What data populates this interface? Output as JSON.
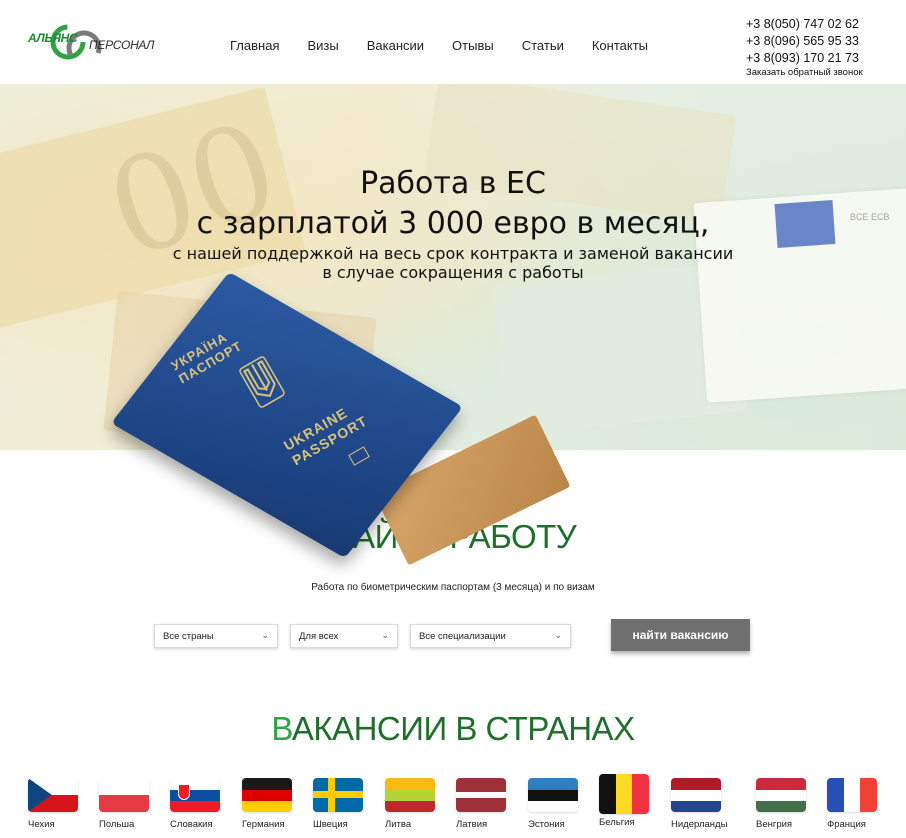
{
  "header": {
    "logo_part1": "АЛЬЯНС",
    "logo_part2": "ПЕРСОНАЛ",
    "nav": [
      "Главная",
      "Визы",
      "Вакансии",
      "Отывы",
      "Статьи",
      "Контакты"
    ],
    "phones": [
      "+3 8(050) 747 02 62",
      "+3 8(096) 565 95 33",
      "+3 8(093) 170 21 73"
    ],
    "callback": "Заказать обратный звонок"
  },
  "hero": {
    "title_line1": "Работа в ЕС",
    "title_line2": "с зарплатой 3 000 евро в месяц,",
    "subtitle": "с нашей поддержкой на весь срок контракта и заменой вакансии в случае сокращения с работы",
    "passport_ua": "УКРАЇНА ПАСПОРТ",
    "passport_en": "UKRAINE PASSPORT",
    "bill_mark": "BCE ECB"
  },
  "find": {
    "title_first": "Н",
    "title_rest": "АЙТИ РАБОТУ",
    "subtitle": "Работа по биометрическим паспортам (3 месяца) и по визам",
    "country_select": "Все страны",
    "who_select": "Для всех",
    "spec_select": "Все специализации",
    "button": "найти вакансию"
  },
  "vacancies": {
    "title_first": "В",
    "title_rest": "АКАНСИИ В СТРАНАХ",
    "countries": [
      "Чехия",
      "Польша",
      "Словакия",
      "Германия",
      "Швеция",
      "Литва",
      "Латвия",
      "Эстония",
      "Бельгия",
      "Нидерланды",
      "Венгрия",
      "Франция"
    ]
  },
  "colors": {
    "brand_green": "#1f6e2c",
    "accent_green": "#2ea344",
    "button_gray": "#6f6f6f"
  }
}
